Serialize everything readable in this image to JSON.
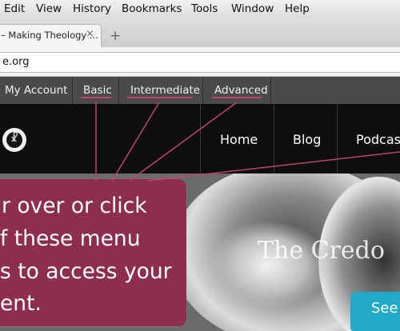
{
  "browser": {
    "menus": [
      "Edit",
      "View",
      "History",
      "Bookmarks",
      "Tools",
      "Window",
      "Help"
    ],
    "tab": {
      "title": "– Making Theology ...",
      "close": "×"
    },
    "new_tab": "+",
    "address": "e.org"
  },
  "site": {
    "account_bar": {
      "my_account": "My Account",
      "levels": [
        "Basic",
        "Intermediate",
        "Advanced"
      ]
    },
    "logo_glyph": "☧",
    "main_menu": [
      "Home",
      "Blog",
      "Podcast"
    ],
    "hero": {
      "title": "The Credo",
      "button": "See"
    },
    "callout": {
      "lines": [
        "r over or click",
        "f these menu",
        "s to access your",
        "ent."
      ]
    }
  },
  "colors": {
    "account_bar_bg": "#4a4a4a",
    "header_bg": "#0e0e0e",
    "callout_bg": "#8e2e4d",
    "pointer": "#c0456b",
    "button": "#21a9c5"
  }
}
